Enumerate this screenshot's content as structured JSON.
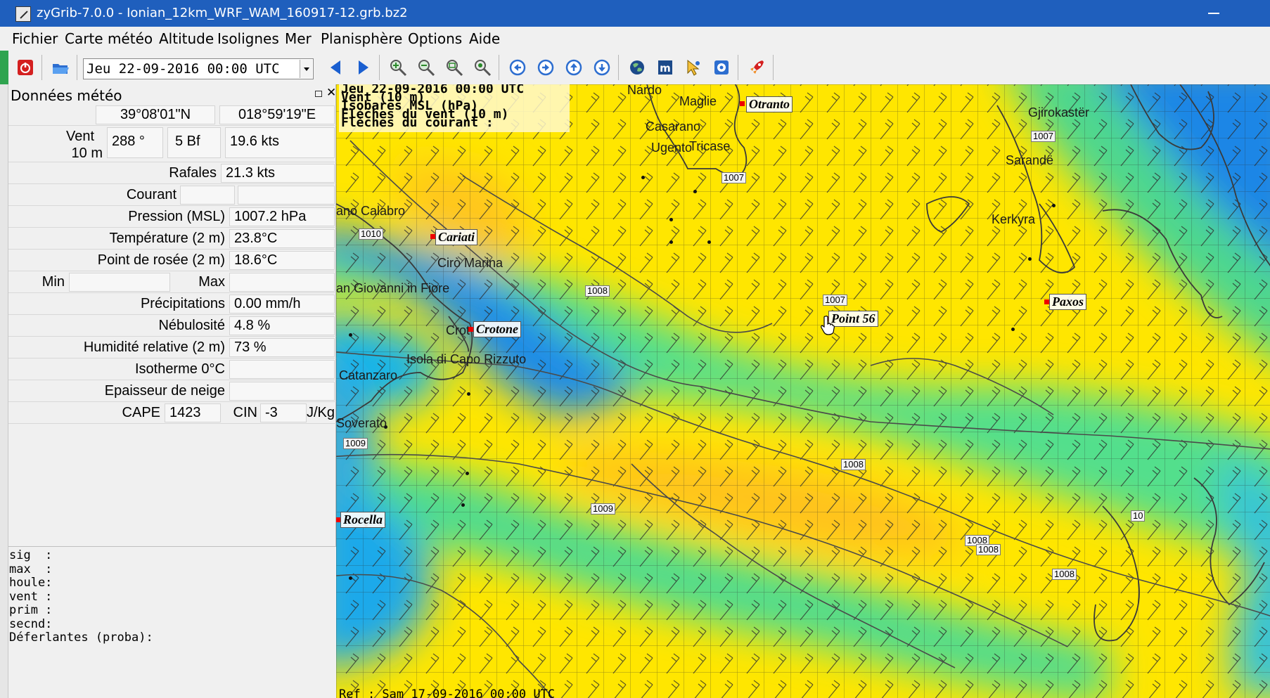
{
  "window": {
    "title": "zyGrib-7.0.0 - Ionian_12km_WRF_WAM_160917-12.grb.bz2"
  },
  "menu": [
    "Fichier",
    "Carte météo",
    "Altitude",
    "Isolignes",
    "Mer",
    "Planisphère",
    "Options",
    "Aide"
  ],
  "toolbar": {
    "date": "Jeu 22-09-2016 00:00 UTC",
    "icons": [
      "power-icon",
      "open-folder-icon",
      "prev-arrow-icon",
      "next-arrow-icon",
      "zoom-in-icon",
      "zoom-out-icon",
      "zoom-area-icon",
      "zoom-fit-icon",
      "pan-left-icon",
      "pan-right-icon",
      "pan-up-icon",
      "pan-down-icon",
      "globe-icon",
      "meteoblue-icon",
      "select-tool-icon",
      "info-icon",
      "rocket-icon"
    ],
    "colors": {
      "blue_arrow": "#1a5fd0",
      "power_red": "#d42020",
      "accent_green": "#2fa44f"
    }
  },
  "panel": {
    "title": "Données météo",
    "lat": "39°08'01\"N",
    "lon": "018°59'19\"E",
    "wind_label_1": "Vent",
    "wind_label_2": "10 m",
    "wind_dir": "288 °",
    "wind_bf": "5 Bf",
    "wind_speed": "19.6  kts",
    "gusts_label": "Rafales",
    "gusts_value": "21.3  kts",
    "current_label": "Courant",
    "pressure_label": "Pression (MSL)",
    "pressure_value": "1007.2 hPa",
    "temp_label": "Température (2 m)",
    "temp_value": "23.8°C",
    "dew_label": "Point de rosée (2 m)",
    "dew_value": "18.6°C",
    "min_label": "Min",
    "max_label": "Max",
    "precip_label": "Précipitations",
    "precip_value": "0.00 mm/h",
    "cloud_label": "Nébulosité",
    "cloud_value": "4.8 %",
    "humidity_label": "Humidité relative (2 m)",
    "humidity_value": "73 %",
    "isotherm_label": "Isotherme 0°C",
    "snow_label": "Epaisseur de neige",
    "cape_label": "CAPE",
    "cape_value": "1423",
    "cin_label": "CIN",
    "cin_value": "-3",
    "cape_unit": "J/Kg",
    "wave_lines": [
      "sig  :",
      "max  :",
      "houle:",
      "vent :",
      "prim :",
      "secnd:",
      "Déferlantes (proba):"
    ]
  },
  "map": {
    "legend": [
      "Jeu 22-09-2016 00:00 UTC",
      "Vent (10 m)",
      "Isobares MSL (hPa)",
      "Flèches du vent (10 m)",
      "Flèches du courant :"
    ],
    "ref": "Ref : Sam 17-09-2016 00:00 UTC",
    "cities": [
      "Nardo",
      "Maglie",
      "Casarano",
      "Ugento",
      "Tricase",
      "Gjirokastër",
      "Sarandë",
      "Kerkyra",
      "ano Calabro",
      "Cirò Marina",
      "an Giovanni in Fiore",
      "Crot",
      "Isola di Capo Rizzuto",
      "Catanzaro",
      "Soverato"
    ],
    "places": [
      "Otranto",
      "Cariati",
      "Crotone",
      "Point 56",
      "Paxos",
      "Rocella"
    ],
    "isobars": [
      "1007",
      "1007",
      "1010",
      "1008",
      "1007",
      "1009",
      "1008",
      "1009",
      "1008",
      "1008",
      "1008",
      "1009",
      "10"
    ],
    "colors": {
      "yellow": "#ffe600",
      "green": "#5fe08a",
      "cyan": "#14b8e8",
      "blue": "#1f7ae0",
      "orange": "#ffc21a"
    }
  }
}
